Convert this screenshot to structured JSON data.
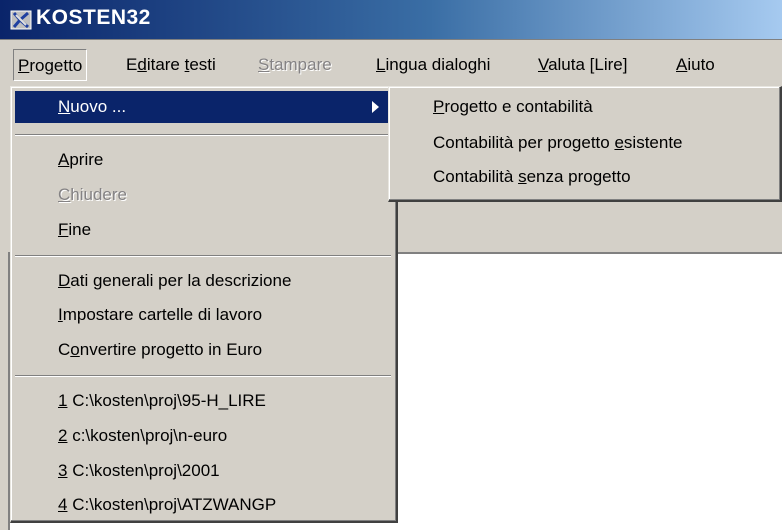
{
  "window": {
    "title": "KOSTEN32"
  },
  "menubar": [
    {
      "pre": "",
      "key": "P",
      "post": "rogetto",
      "state": "pressed"
    },
    {
      "pre": "E",
      "key": "d",
      "post": "itare ",
      "key2": "t",
      "post2": "esti",
      "state": "normal"
    },
    {
      "pre": "",
      "key": "S",
      "post": "tampare",
      "state": "disabled"
    },
    {
      "pre": "",
      "key": "L",
      "post": "ingua dialoghi",
      "state": "normal"
    },
    {
      "pre": "",
      "key": "V",
      "post": "aluta [Lire]",
      "state": "normal"
    },
    {
      "pre": "",
      "key": "A",
      "post": "iuto",
      "state": "normal"
    }
  ],
  "file_menu": {
    "new": {
      "pre": "",
      "key": "N",
      "post": "uovo ..."
    },
    "open": {
      "pre": "",
      "key": "A",
      "post": "prire"
    },
    "close": {
      "pre": "",
      "key": "C",
      "post": "hiudere"
    },
    "exit": {
      "pre": "",
      "key": "F",
      "post": "ine"
    },
    "general_data": {
      "pre": "",
      "key": "D",
      "post": "ati generali per la descrizione"
    },
    "work_folders": {
      "pre": "",
      "key": "I",
      "post": "mpostare cartelle di lavoro"
    },
    "convert_euro": {
      "pre": "C",
      "key": "o",
      "post": "nvertire progetto in Euro"
    },
    "recent": [
      {
        "pre": "",
        "key": "1",
        "post": " C:\\kosten\\proj\\95-H_LIRE"
      },
      {
        "pre": "",
        "key": "2",
        "post": " c:\\kosten\\proj\\n-euro"
      },
      {
        "pre": "",
        "key": "3",
        "post": " C:\\kosten\\proj\\2001"
      },
      {
        "pre": "",
        "key": "4",
        "post": " C:\\kosten\\proj\\ATZWANGP"
      }
    ]
  },
  "new_submenu": [
    {
      "pre": "",
      "key": "P",
      "post": "rogetto e contabilità"
    },
    {
      "pre": "Contabilità per progetto ",
      "key": "e",
      "post": "sistente"
    },
    {
      "pre": "Contabilità ",
      "key": "s",
      "post": "enza progetto"
    }
  ],
  "colors": {
    "highlight": "#0a246a",
    "menu_bg": "#d4d0c8",
    "disabled": "#848284"
  }
}
